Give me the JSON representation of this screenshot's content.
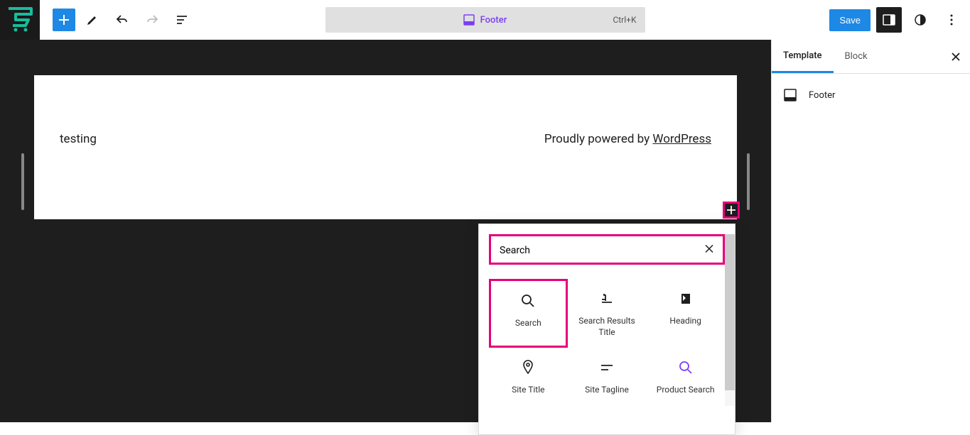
{
  "topbar": {
    "document": {
      "label": "Footer",
      "shortcut": "Ctrl+K"
    },
    "save_label": "Save"
  },
  "canvas": {
    "left_text": "testing",
    "powered_prefix": "Proudly powered by ",
    "powered_link": "WordPress"
  },
  "inserter": {
    "search_value": "Search",
    "blocks": [
      {
        "label": "Search"
      },
      {
        "label": "Search Results Title"
      },
      {
        "label": "Heading"
      },
      {
        "label": "Site Title"
      },
      {
        "label": "Site Tagline"
      },
      {
        "label": "Product Search"
      }
    ]
  },
  "sidebar": {
    "tabs": {
      "template": "Template",
      "block": "Block"
    },
    "item_label": "Footer"
  }
}
